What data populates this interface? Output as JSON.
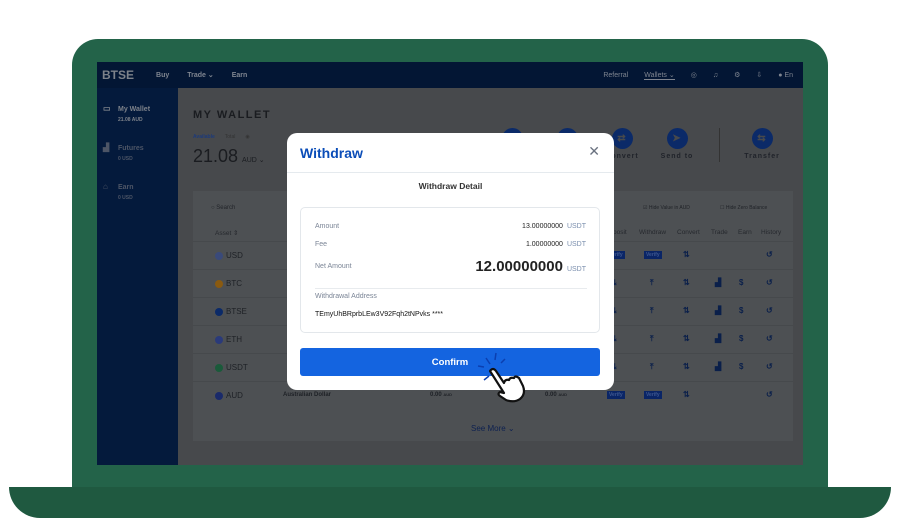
{
  "topbar": {
    "logo": "BTSE",
    "nav": [
      "Buy",
      "Trade ⌄",
      "Earn"
    ],
    "right": [
      "Referral",
      "Wallets ⌄"
    ],
    "lang": "En"
  },
  "sidebar": {
    "items": [
      {
        "label": "My Wallet",
        "sub": "21.08 AUD",
        "icon": "wallet-icon"
      },
      {
        "label": "Futures",
        "sub": "0 USD",
        "icon": "chart-icon"
      },
      {
        "label": "Earn",
        "sub": "0 USD",
        "icon": "earn-icon"
      }
    ]
  },
  "wallet": {
    "title": "MY WALLET",
    "available": "Available",
    "total": "Total",
    "balance": "21.08",
    "currency": "AUD ⌄",
    "actions": [
      "Convert",
      "Send to",
      "Transfer"
    ]
  },
  "table": {
    "search_placeholder": "Search",
    "hide_value": "Hide Value in AUD",
    "hide_zero": "Hide Zero Balance",
    "headers": [
      "Asset ⇕",
      "posit",
      "Withdraw",
      "Convert",
      "Trade",
      "Earn",
      "History"
    ],
    "rows": [
      {
        "asset": "USD",
        "color": "#3a4a7a"
      },
      {
        "asset": "BTC",
        "color": "#8a5a10"
      },
      {
        "asset": "BTSE",
        "color": "#0b2a68"
      },
      {
        "asset": "ETH",
        "color": "#2a3a7a"
      },
      {
        "asset": "USDT",
        "color": "#1a5a3a"
      },
      {
        "asset": "AUD",
        "color": "#1a2a6a",
        "name": "Australian Dollar",
        "available": "0.00",
        "total": "0.00",
        "unit": "AUD"
      }
    ],
    "verify": "Verify",
    "see_more": "See More ⌄"
  },
  "modal": {
    "title": "Withdraw",
    "subtitle": "Withdraw Detail",
    "amount_label": "Amount",
    "amount": "13.00000000",
    "fee_label": "Fee",
    "fee": "1.00000000",
    "net_label": "Net Amount",
    "net": "12.00000000",
    "unit": "USDT",
    "address_label": "Withdrawal Address",
    "address": "TEmyUhBRprbLEw3V92Fqh2tNPvks ****",
    "confirm": "Confirm"
  },
  "colors": {
    "laptop": "#236349",
    "accent": "#1464e0",
    "title": "#0b4db8"
  }
}
